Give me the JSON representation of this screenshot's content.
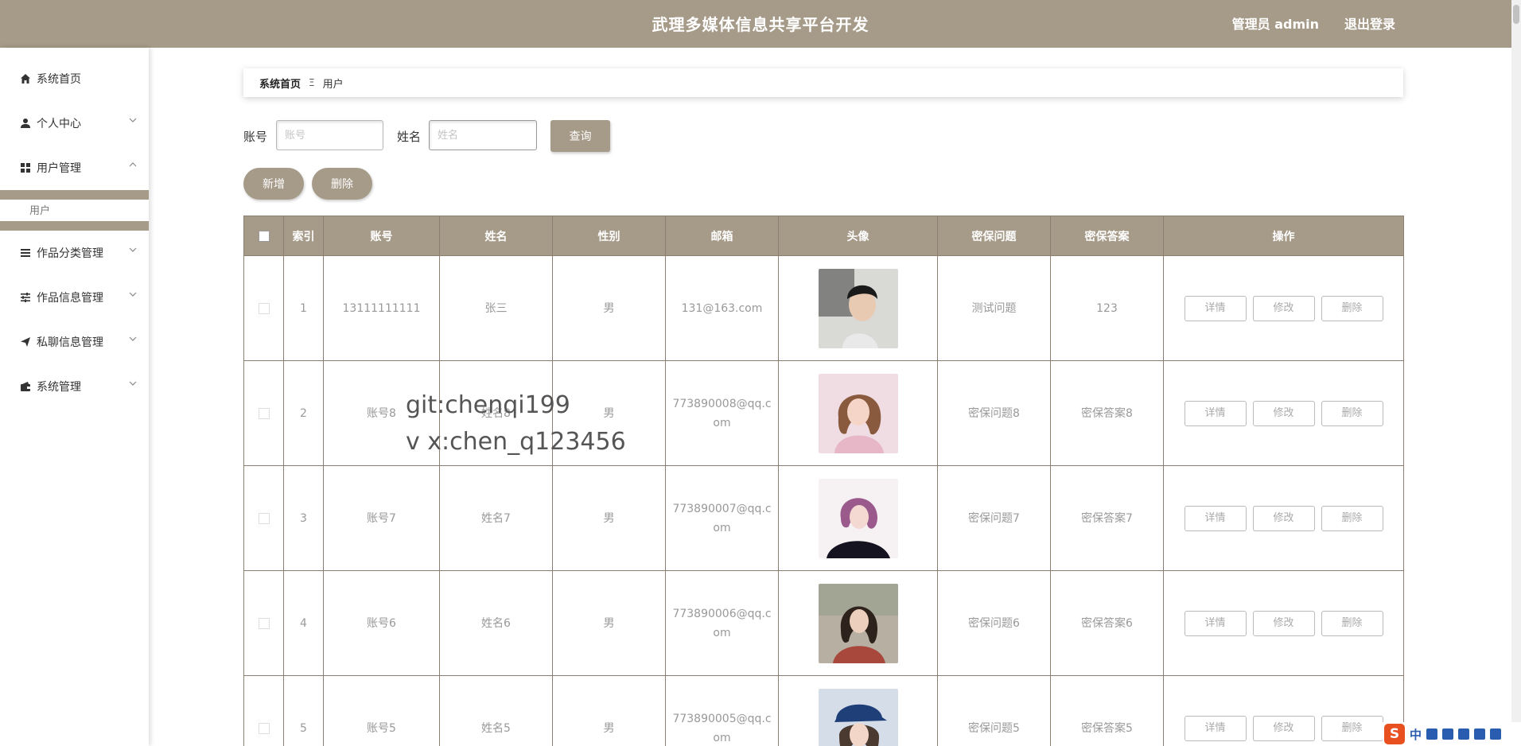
{
  "header": {
    "title": "武理多媒体信息共享平台开发",
    "user": "管理员 admin",
    "logout": "退出登录"
  },
  "sidebar": {
    "items": [
      {
        "label": "系统首页",
        "icon": "home-icon"
      },
      {
        "label": "个人中心",
        "icon": "user-icon"
      },
      {
        "label": "用户管理",
        "icon": "grid-icon"
      },
      {
        "label": "作品分类管理",
        "icon": "list-icon"
      },
      {
        "label": "作品信息管理",
        "icon": "sliders-icon"
      },
      {
        "label": "私聊信息管理",
        "icon": "send-icon"
      },
      {
        "label": "系统管理",
        "icon": "wallet-icon"
      }
    ],
    "sub_item": "用户"
  },
  "breadcrumb": {
    "home": "系统首页",
    "separator": "Ξ",
    "current": "用户"
  },
  "search": {
    "account_label": "账号",
    "account_placeholder": "账号",
    "name_label": "姓名",
    "name_placeholder": "姓名",
    "query_button": "查询"
  },
  "actions": {
    "add": "新增",
    "delete": "删除"
  },
  "table": {
    "headers": [
      "索引",
      "账号",
      "姓名",
      "性别",
      "邮箱",
      "头像",
      "密保问题",
      "密保答案",
      "操作"
    ],
    "rows": [
      {
        "index": "1",
        "account": "13111111111",
        "name": "张三",
        "gender": "男",
        "email": "131@163.com",
        "question": "测试问题",
        "answer": "123"
      },
      {
        "index": "2",
        "account": "账号8",
        "name": "姓名8",
        "gender": "男",
        "email": "773890008@qq.com",
        "question": "密保问题8",
        "answer": "密保答案8"
      },
      {
        "index": "3",
        "account": "账号7",
        "name": "姓名7",
        "gender": "男",
        "email": "773890007@qq.com",
        "question": "密保问题7",
        "answer": "密保答案7"
      },
      {
        "index": "4",
        "account": "账号6",
        "name": "姓名6",
        "gender": "男",
        "email": "773890006@qq.com",
        "question": "密保问题6",
        "answer": "密保答案6"
      },
      {
        "index": "5",
        "account": "账号5",
        "name": "姓名5",
        "gender": "男",
        "email": "773890005@qq.com",
        "question": "密保问题5",
        "answer": "密保答案5"
      }
    ],
    "ops": {
      "detail": "详情",
      "edit": "修改",
      "delete": "删除"
    }
  },
  "watermark": {
    "line1": "git:chenqi199",
    "line2": "v x:chen_q123456"
  },
  "ime": {
    "logo": "S",
    "mode": "中"
  },
  "colors": {
    "accent": "#a69a88"
  }
}
